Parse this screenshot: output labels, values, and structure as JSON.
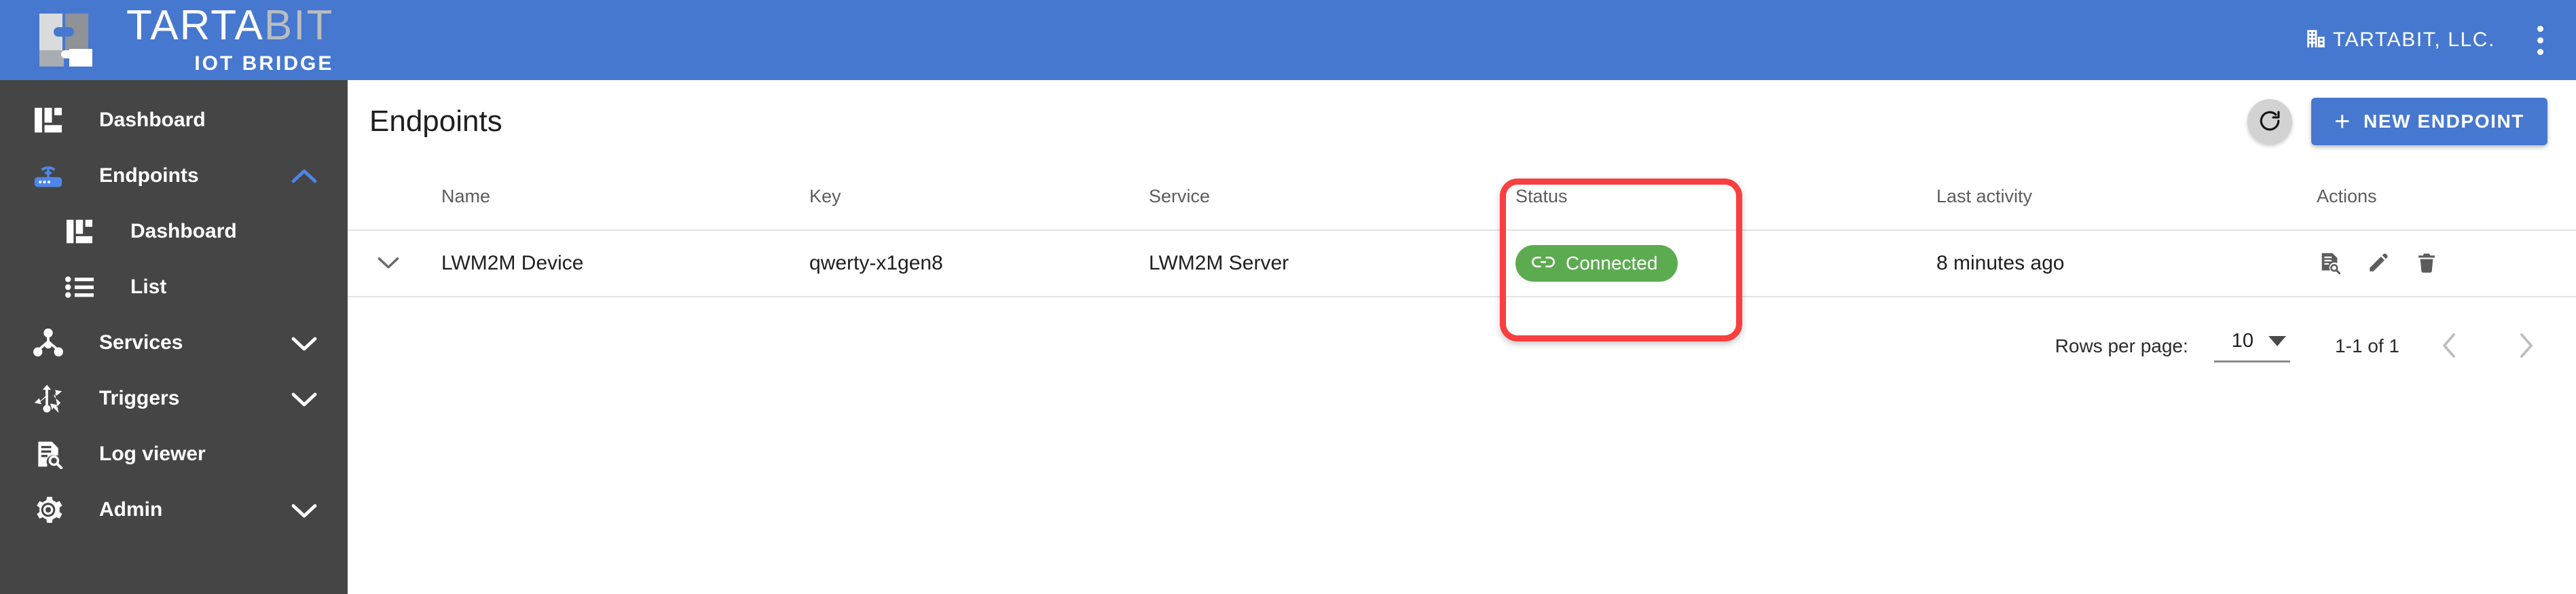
{
  "topbar": {
    "brand_primary": "TARTA",
    "brand_secondary": "BIT",
    "brand_subtitle": "IOT BRIDGE",
    "org_name": "TARTABIT, LLC.",
    "bg_color": "#4678cf",
    "menu_icon": "kebab-menu-icon",
    "org_icon": "building-icon",
    "logo_icon": "puzzle-piece-logo-icon"
  },
  "sidebar": {
    "bg_color": "#454545",
    "items": [
      {
        "label": "Dashboard",
        "icon": "dashboard-icon",
        "level": "top",
        "expandable": false,
        "active": false
      },
      {
        "label": "Endpoints",
        "icon": "router-icon",
        "level": "top",
        "expandable": true,
        "expanded": true,
        "active": true
      },
      {
        "label": "Dashboard",
        "icon": "dashboard-icon",
        "level": "sub",
        "expandable": false,
        "active": false
      },
      {
        "label": "List",
        "icon": "list-icon",
        "level": "sub",
        "expandable": false,
        "active": false
      },
      {
        "label": "Services",
        "icon": "hierarchy-icon",
        "level": "top",
        "expandable": true,
        "expanded": false,
        "active": false
      },
      {
        "label": "Triggers",
        "icon": "move-arrows-icon",
        "level": "top",
        "expandable": true,
        "expanded": false,
        "active": false
      },
      {
        "label": "Log viewer",
        "icon": "log-search-icon",
        "level": "top",
        "expandable": false,
        "active": false
      },
      {
        "label": "Admin",
        "icon": "gear-icon",
        "level": "top",
        "expandable": true,
        "expanded": false,
        "active": false
      }
    ]
  },
  "page": {
    "title": "Endpoints",
    "refresh_label": "Refresh",
    "refresh_icon": "refresh-icon",
    "new_endpoint_label": "NEW ENDPOINT",
    "new_endpoint_plus": "+",
    "accent_color": "#4678cf"
  },
  "table": {
    "headers": {
      "name": "Name",
      "key": "Key",
      "service": "Service",
      "status": "Status",
      "last_activity": "Last activity",
      "actions": "Actions"
    },
    "rows": [
      {
        "expand_icon": "chevron-down-icon",
        "name": "LWM2M Device",
        "key": "qwerty-x1gen8",
        "service": "LWM2M Server",
        "status_label": "Connected",
        "status_icon": "link-icon",
        "status_color": "#5cab50",
        "last_activity": "8 minutes ago",
        "actions": [
          "log-viewer-icon",
          "edit-pencil-icon",
          "delete-trash-icon"
        ]
      }
    ]
  },
  "pagination": {
    "rows_per_page_label": "Rows per page:",
    "rows_per_page_value": "10",
    "range_label": "1-1 of 1",
    "prev_icon": "chevron-left-icon",
    "next_icon": "chevron-right-icon"
  },
  "annotation": {
    "color": "#f93f3f",
    "target": "status-column"
  }
}
